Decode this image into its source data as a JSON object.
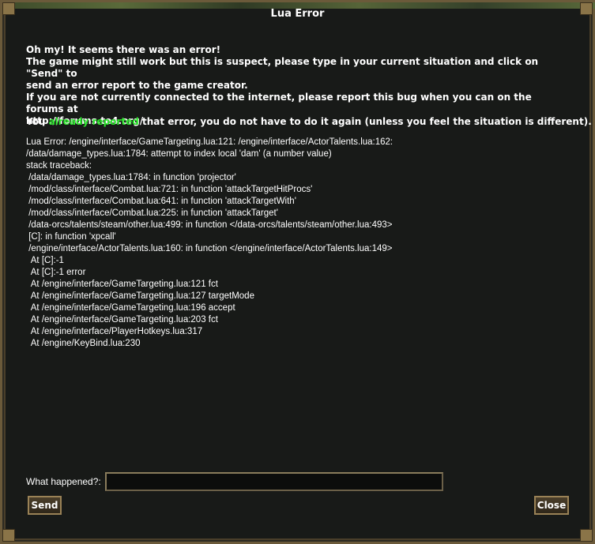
{
  "window": {
    "title": "Lua Error"
  },
  "intro": {
    "line1": "Oh my! It seems there was an error!",
    "line2": "The game might still work but this is suspect, please type in your current situation and click on \"Send\" to",
    "line3": "send an error report to the game creator.",
    "line4": "If you are not currently connected to the internet, please report this bug when you can on the forums at",
    "line5": "http://forums.te4.org/"
  },
  "reported": {
    "prefix": "You ",
    "highlight": "already reported",
    "suffix": " that error, you do not have to do it again (unless you feel the situation is different)."
  },
  "trace": [
    "Lua Error: /engine/interface/GameTargeting.lua:121: /engine/interface/ActorTalents.lua:162:",
    "/data/damage_types.lua:1784: attempt to index local 'dam' (a number value)",
    "stack traceback:",
    " /data/damage_types.lua:1784: in function 'projector'",
    " /mod/class/interface/Combat.lua:721: in function 'attackTargetHitProcs'",
    " /mod/class/interface/Combat.lua:641: in function 'attackTargetWith'",
    " /mod/class/interface/Combat.lua:225: in function 'attackTarget'",
    " /data-orcs/talents/steam/other.lua:499: in function </data-orcs/talents/steam/other.lua:493>",
    " [C]: in function 'xpcall'",
    " /engine/interface/ActorTalents.lua:160: in function </engine/interface/ActorTalents.lua:149>",
    "  At [C]:-1",
    "  At [C]:-1 error",
    "  At /engine/interface/GameTargeting.lua:121 fct",
    "  At /engine/interface/GameTargeting.lua:127 targetMode",
    "  At /engine/interface/GameTargeting.lua:196 accept",
    "  At /engine/interface/GameTargeting.lua:203 fct",
    "  At /engine/interface/PlayerHotkeys.lua:317",
    "  At /engine/KeyBind.lua:230"
  ],
  "form": {
    "what_label": "What happened?:",
    "what_value": "",
    "send_label": "Send",
    "close_label": "Close"
  },
  "colors": {
    "highlight": "#2ee82e",
    "frame": "#6b5a3a",
    "background": "#181a18"
  }
}
